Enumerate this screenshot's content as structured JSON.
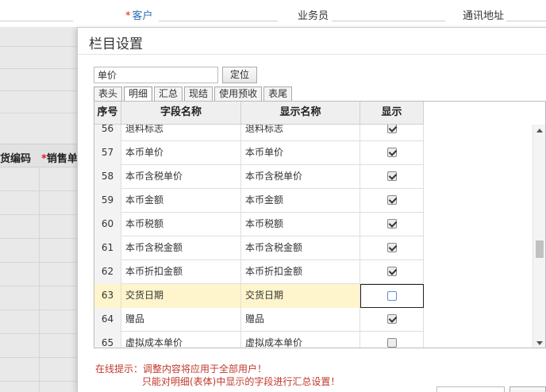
{
  "background": {
    "customer_required": "*",
    "customer_label": "客户",
    "salesperson_label": "业务员",
    "address_label": "通讯地址",
    "col_goods_code": "货编码",
    "col_sales_required": "*",
    "col_sales": "销售单"
  },
  "dialog": {
    "title": "栏目设置",
    "search_value": "单价",
    "locate_button": "定位",
    "tabs": [
      {
        "label": "表头"
      },
      {
        "label": "明细"
      },
      {
        "label": "汇总"
      },
      {
        "label": "现结"
      },
      {
        "label": "使用预收"
      },
      {
        "label": "表尾"
      }
    ],
    "active_tab": "明细",
    "columns": {
      "no": "序号",
      "field": "字段名称",
      "display": "显示名称",
      "show": "显示"
    },
    "rows": [
      {
        "no": "56",
        "field": "退料标志",
        "display": "退料标志",
        "show": true
      },
      {
        "no": "57",
        "field": "本币单价",
        "display": "本币单价",
        "show": true
      },
      {
        "no": "58",
        "field": "本币含税单价",
        "display": "本币含税单价",
        "show": true
      },
      {
        "no": "59",
        "field": "本币金额",
        "display": "本币金额",
        "show": true
      },
      {
        "no": "60",
        "field": "本币税额",
        "display": "本币税额",
        "show": true
      },
      {
        "no": "61",
        "field": "本币含税金额",
        "display": "本币含税金额",
        "show": true
      },
      {
        "no": "62",
        "field": "本币折扣金额",
        "display": "本币折扣金额",
        "show": true
      },
      {
        "no": "63",
        "field": "交货日期",
        "display": "交货日期",
        "show": false
      },
      {
        "no": "64",
        "field": "赠品",
        "display": "赠品",
        "show": true
      },
      {
        "no": "65",
        "field": "虚拟成本单价",
        "display": "虚拟成本单价",
        "show": false
      }
    ],
    "selected_row_no": "63",
    "tip_line1": "在线提示：调整内容将应用于全部用户！",
    "tip_line2": "只能对明细(表体)中显示的字段进行汇总设置！"
  },
  "colors": {
    "selected_row": "#fff5cc",
    "tip_text": "#c0392b",
    "required_star": "#e02020",
    "customer_label": "#2c6fb3"
  }
}
